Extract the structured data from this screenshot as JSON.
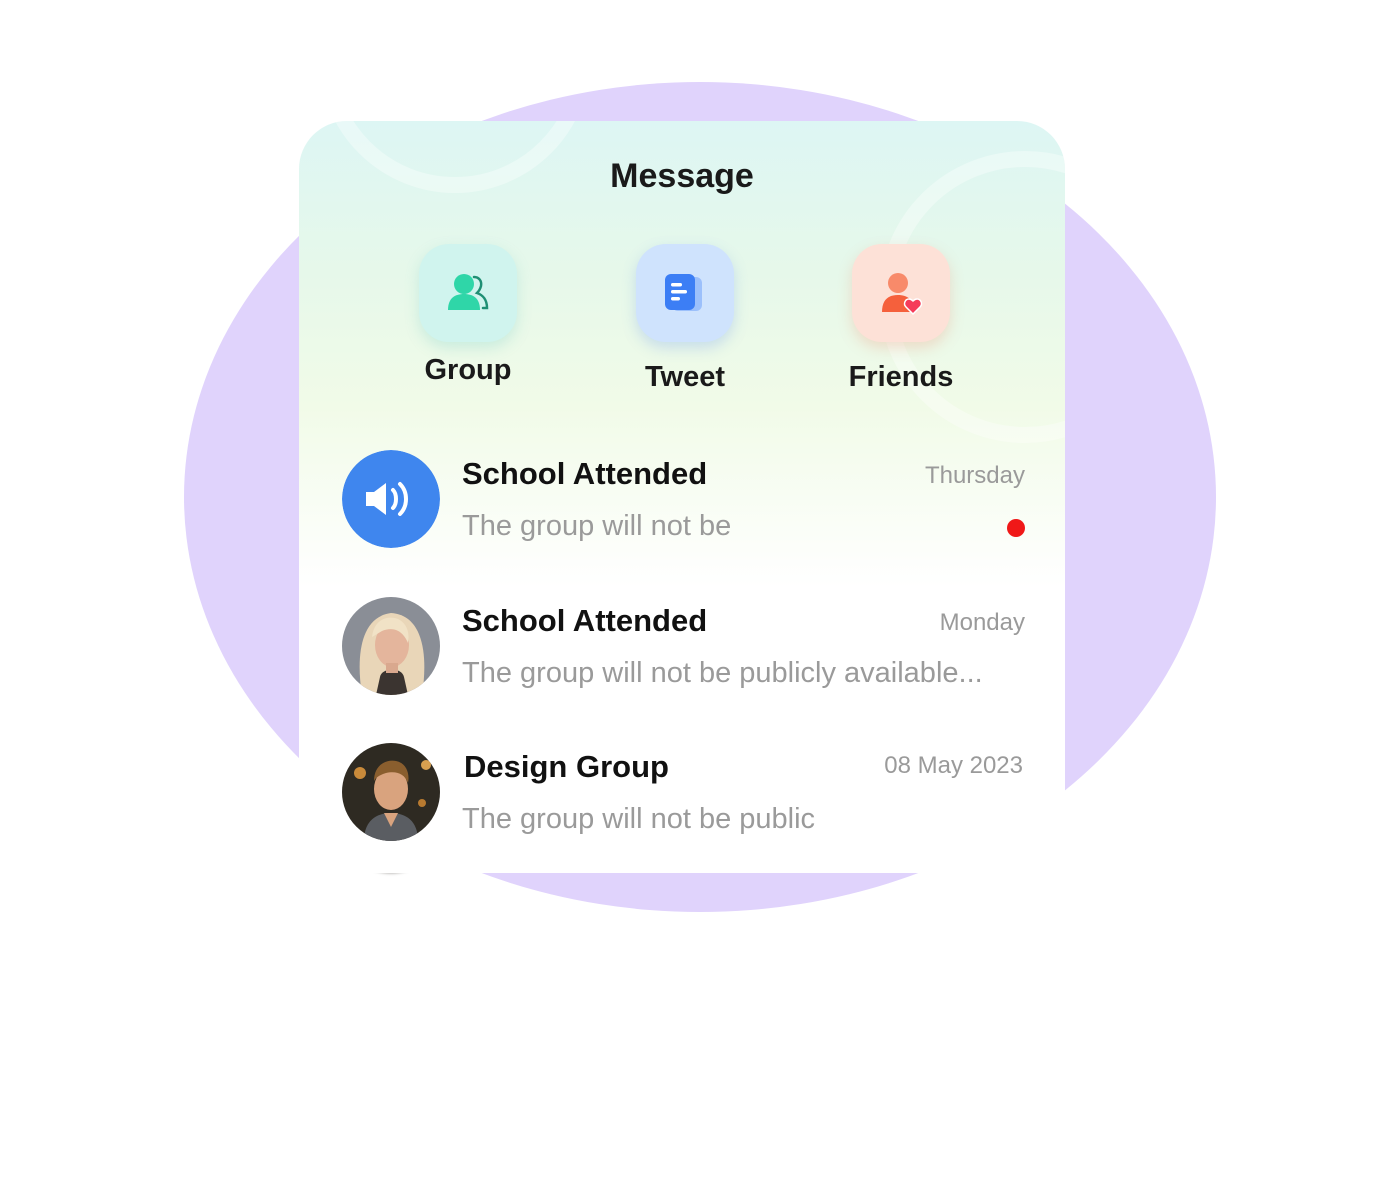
{
  "header": {
    "title": "Message"
  },
  "actions": [
    {
      "label": "Group",
      "icon": "group-icon",
      "color": "#2fd6a8"
    },
    {
      "label": "Tweet",
      "icon": "document-icon",
      "color": "#3c7ef5"
    },
    {
      "label": "Friends",
      "icon": "friend-heart-icon",
      "color": "#f5603c"
    }
  ],
  "conversations": [
    {
      "name": "School Attended",
      "date": "Thursday",
      "preview": "The group will not be",
      "unread": true,
      "avatar": "speaker-icon"
    },
    {
      "name": "School Attended",
      "date": "Monday",
      "preview": "The group will not be publicly available...",
      "unread": false,
      "avatar": "woman-photo"
    },
    {
      "name": "Design Group",
      "date": "08 May 2023",
      "preview": "The group will not be public",
      "unread": false,
      "avatar": "man-photo"
    }
  ],
  "colors": {
    "background_blob": "#e0d3fc",
    "unread_dot": "#f01818",
    "speaker_avatar": "#3f86ee"
  }
}
